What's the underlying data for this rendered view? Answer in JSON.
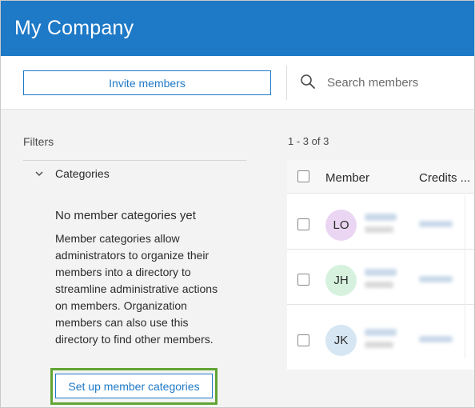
{
  "header": {
    "title": "My Company",
    "bg_color": "#1e79c7"
  },
  "toolbar": {
    "invite_label": "Invite members",
    "search_placeholder": "Search members",
    "search_icon": "search-icon"
  },
  "filters": {
    "label": "Filters",
    "category_section": {
      "label": "Categories",
      "expanded": true,
      "empty_title": "No member categories yet",
      "empty_description": "Member categories allow administrators to organize their members into a directory to streamline administrative actions on members. Organization members can also use this directory to find other members.",
      "setup_label": "Set up member categories",
      "highlight_color": "#61a534"
    }
  },
  "results": {
    "count_text": "1 - 3 of 3",
    "columns": [
      "Member",
      "Credits ..."
    ],
    "rows": [
      {
        "initials": "LO",
        "avatar_color": "#ead6f2"
      },
      {
        "initials": "JH",
        "avatar_color": "#d6f2de"
      },
      {
        "initials": "JK",
        "avatar_color": "#d6e6f2"
      }
    ]
  }
}
